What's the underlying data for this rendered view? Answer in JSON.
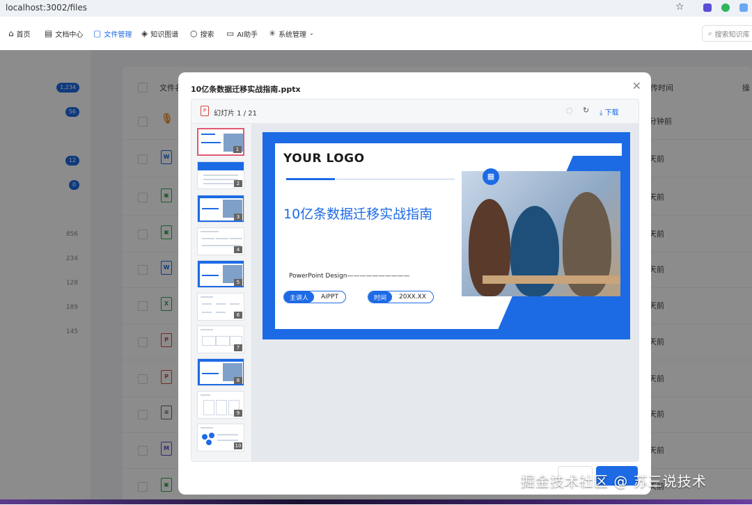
{
  "browser": {
    "url": "localhost:3002/files"
  },
  "nav": {
    "items": [
      {
        "label": "首页",
        "icon": "home-icon"
      },
      {
        "label": "文档中心",
        "icon": "document-icon"
      },
      {
        "label": "文件管理",
        "icon": "file-icon",
        "active": true
      },
      {
        "label": "知识图谱",
        "icon": "graph-icon"
      },
      {
        "label": "搜索",
        "icon": "search-icon"
      },
      {
        "label": "AI助手",
        "icon": "chat-icon"
      },
      {
        "label": "系统管理",
        "icon": "settings-icon"
      }
    ],
    "search_placeholder": "搜索知识库"
  },
  "sidebar": {
    "badges": [
      "1,234",
      "56",
      "12",
      "0"
    ],
    "counts": [
      "856",
      "234",
      "128",
      "189",
      "145"
    ]
  },
  "table": {
    "headers": {
      "name": "文件名",
      "upload_time": "传时间",
      "actions": "操"
    },
    "rows": [
      {
        "type": "audio",
        "time": "分钟前"
      },
      {
        "type": "W",
        "time": "天前"
      },
      {
        "type": "img",
        "time": "天前"
      },
      {
        "type": "img",
        "time": "天前"
      },
      {
        "type": "W",
        "time": "天前"
      },
      {
        "type": "X",
        "time": "天前"
      },
      {
        "type": "P",
        "time": "天前"
      },
      {
        "type": "P",
        "time": "天前"
      },
      {
        "type": "txt",
        "time": "天前"
      },
      {
        "type": "M",
        "time": "天前"
      },
      {
        "type": "img",
        "time": "天前"
      }
    ]
  },
  "modal": {
    "title": "10亿条数据迁移实战指南.pptx",
    "slide_counter": "幻灯片 1 / 21",
    "download_label": "下载",
    "thumb_count": 10,
    "slide": {
      "logo": "YOUR LOGO",
      "headline": "10亿条数据迁移实战指南",
      "subtitle": "PowerPoint Design——————————",
      "speaker_key": "主讲人",
      "speaker_value": "AiPPT",
      "time_key": "时间",
      "time_value": "20XX.XX"
    }
  },
  "watermark": "掘金技术社区 @ 苏三说技术",
  "colors": {
    "accent": "#1d6ae5",
    "active_thumb": "#e05a72",
    "progress": "#f08a24"
  }
}
